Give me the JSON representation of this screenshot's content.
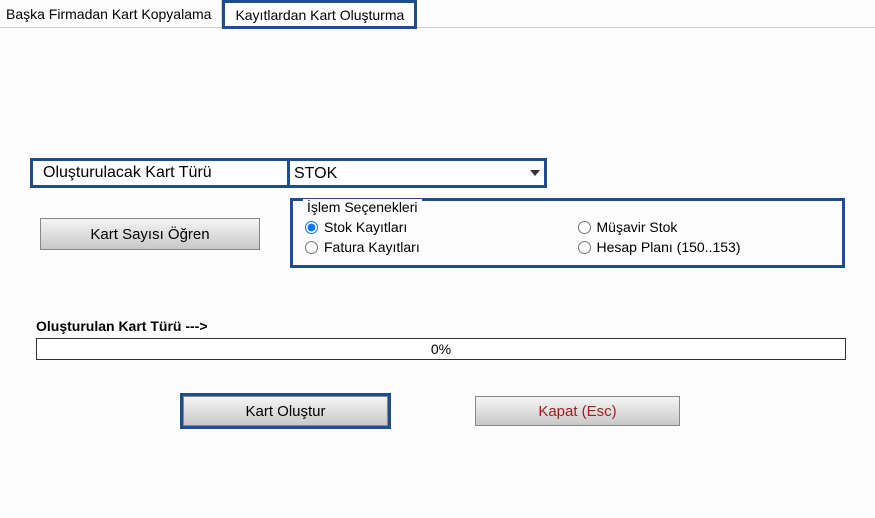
{
  "tabs": {
    "tab1": "Başka Firmadan Kart Kopyalama",
    "tab2": "Kayıtlardan Kart Oluşturma"
  },
  "cardType": {
    "label": "Oluşturulacak Kart Türü",
    "selected": "STOK"
  },
  "buttons": {
    "count": "Kart Sayısı Öğren",
    "create": "Kart Oluştur",
    "close": "Kapat (Esc)"
  },
  "options": {
    "title": "İşlem Seçenekleri",
    "opt1": "Stok Kayıtları",
    "opt2": "Müşavir Stok",
    "opt3": "Fatura Kayıtları",
    "opt4": "Hesap Planı (150..153)"
  },
  "progress": {
    "label": "Oluşturulan Kart Türü --->",
    "value": "0%"
  }
}
